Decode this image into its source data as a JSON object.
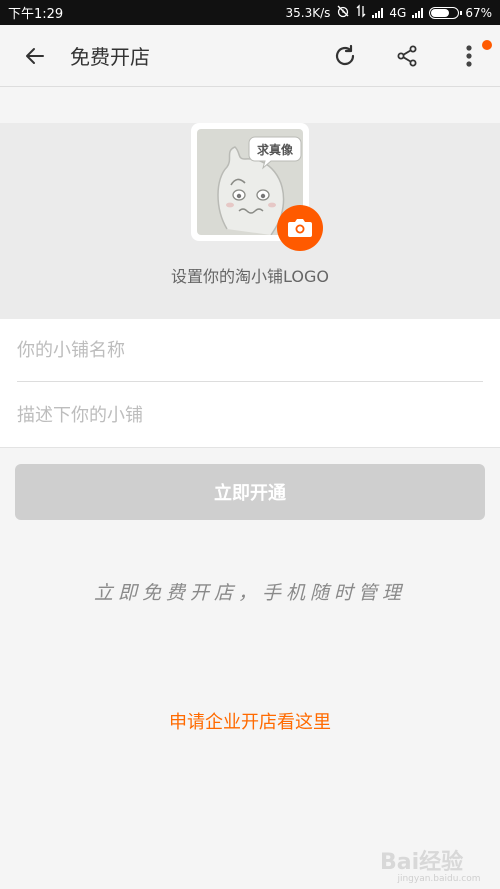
{
  "status_bar": {
    "time": "下午1:29",
    "network_speed": "35.3K/s",
    "network_type": "4G",
    "battery_percent": "67%",
    "battery_level": 0.67
  },
  "header": {
    "title": "免费开店",
    "icons": [
      "back-arrow-icon",
      "refresh-icon",
      "share-icon",
      "more-icon"
    ]
  },
  "logo_section": {
    "placeholder_badge": "求真像",
    "label": "设置你的淘小铺LOGO"
  },
  "form": {
    "shop_name_placeholder": "你的小铺名称",
    "shop_name_value": "",
    "description_placeholder": "描述下你的小铺",
    "description_value": ""
  },
  "submit_label": "立即开通",
  "slogan": "立即免费开店，手机随时管理",
  "enterprise_link": "申请企业开店看这里",
  "watermark": {
    "text": "Bai经验",
    "url": "jingyan.baidu.com"
  },
  "colors": {
    "accent": "#ff5a00",
    "button_disabled": "#cfcfcf"
  }
}
